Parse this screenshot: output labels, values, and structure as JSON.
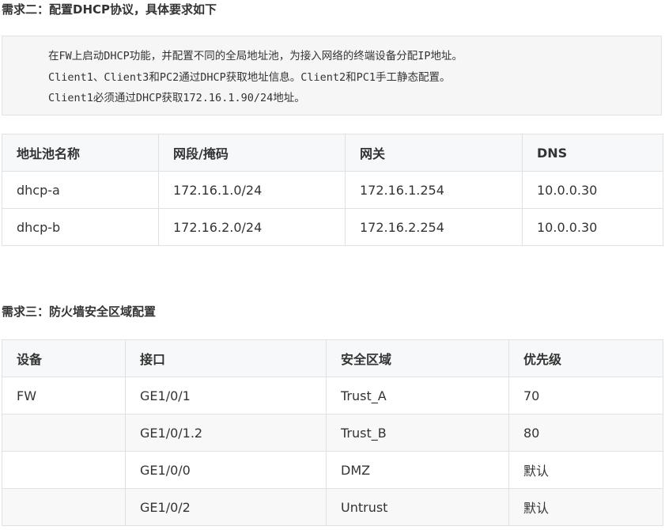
{
  "section_dhcp": {
    "heading": "需求二：配置DHCP协议，具体要求如下",
    "quote": {
      "line1": [
        "在",
        "FW",
        "上启动",
        "DHCP",
        "功能，并配置不同的全局地址池，为接入网络的终端设备分配",
        "IP",
        "地址。"
      ],
      "line2": [
        "Client1",
        "、",
        "Client3",
        "和",
        "PC2",
        "通过",
        "DHCP",
        "获取地址信息。",
        "Client2",
        "和",
        "PC1",
        "手工静态配置。"
      ],
      "line3": [
        "Client1",
        "必须通过",
        "DHCP",
        "获取",
        "172.16.1.90/24",
        "地址。"
      ]
    },
    "table": {
      "headers": [
        "地址池名称",
        "网段/掩码",
        "网关",
        "DNS"
      ],
      "rows": [
        [
          "dhcp-a",
          "172.16.1.0/24",
          "172.16.1.254",
          "10.0.0.30"
        ],
        [
          "dhcp-b",
          "172.16.2.0/24",
          "172.16.2.254",
          "10.0.0.30"
        ]
      ]
    }
  },
  "section_zone": {
    "heading": "需求三：防火墙安全区域配置",
    "table": {
      "headers": [
        "设备",
        "接口",
        "安全区域",
        "优先级"
      ],
      "rows": [
        [
          "FW",
          "GE1/0/1",
          "Trust_A",
          "70"
        ],
        [
          "",
          "GE1/0/1.2",
          "Trust_B",
          "80"
        ],
        [
          "",
          "GE1/0/0",
          "DMZ",
          "默认"
        ],
        [
          "",
          "GE1/0/2",
          "Untrust",
          "默认"
        ]
      ]
    }
  }
}
